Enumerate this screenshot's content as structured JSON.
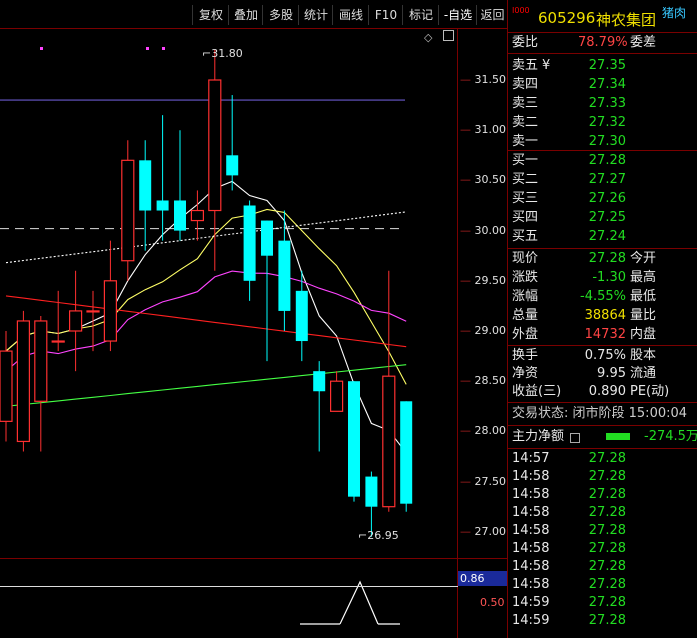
{
  "toolbar": {
    "buttons": [
      "复权",
      "叠加",
      "多股",
      "统计",
      "画线",
      "F10",
      "标记",
      "-自选",
      "返回"
    ]
  },
  "chart": {
    "price_ticks": [
      "31.50",
      "31.00",
      "30.50",
      "30.00",
      "29.50",
      "29.00",
      "28.50",
      "28.00",
      "27.50",
      "27.00"
    ],
    "high_label": "31.80",
    "low_label": "26.95",
    "sub_ticks": [
      "0.86",
      "0.50"
    ],
    "colors": {
      "up": "#ff3030",
      "down": "#00ffff",
      "ma5": "#ffffff",
      "ma10": "#ffff66",
      "ma20": "#ff44ff",
      "ma60": "#44ff44",
      "ma120": "#ff2020",
      "ref_white": "#ffffff",
      "ref_blue": "#6a5acd"
    }
  },
  "chart_data": {
    "type": "candlestick",
    "candles": [
      {
        "o": 28.1,
        "c": 28.8,
        "h": 29.0,
        "l": 27.9
      },
      {
        "o": 27.9,
        "c": 29.1,
        "h": 29.2,
        "l": 27.8
      },
      {
        "o": 28.3,
        "c": 29.1,
        "h": 29.15,
        "l": 27.8
      },
      {
        "o": 28.9,
        "c": 28.9,
        "h": 29.4,
        "l": 28.8
      },
      {
        "o": 29.0,
        "c": 29.2,
        "h": 29.6,
        "l": 28.6
      },
      {
        "o": 29.2,
        "c": 29.2,
        "h": 29.4,
        "l": 28.8
      },
      {
        "o": 28.9,
        "c": 29.5,
        "h": 29.9,
        "l": 28.8
      },
      {
        "o": 29.7,
        "c": 30.7,
        "h": 30.9,
        "l": 29.5
      },
      {
        "o": 30.7,
        "c": 30.2,
        "h": 30.9,
        "l": 29.8
      },
      {
        "o": 30.3,
        "c": 30.2,
        "h": 31.15,
        "l": 29.9
      },
      {
        "o": 30.3,
        "c": 30.0,
        "h": 31.0,
        "l": 29.9
      },
      {
        "o": 30.1,
        "c": 30.2,
        "h": 30.4,
        "l": 29.9
      },
      {
        "o": 30.2,
        "c": 31.5,
        "h": 31.8,
        "l": 29.6
      },
      {
        "o": 30.75,
        "c": 30.55,
        "h": 31.35,
        "l": 30.4
      },
      {
        "o": 30.25,
        "c": 29.5,
        "h": 30.3,
        "l": 29.3
      },
      {
        "o": 30.1,
        "c": 29.75,
        "h": 30.1,
        "l": 28.7
      },
      {
        "o": 29.9,
        "c": 29.2,
        "h": 30.2,
        "l": 29.0
      },
      {
        "o": 29.4,
        "c": 28.9,
        "h": 29.6,
        "l": 28.7
      },
      {
        "o": 28.6,
        "c": 28.4,
        "h": 28.7,
        "l": 27.8
      },
      {
        "o": 28.2,
        "c": 28.5,
        "h": 28.6,
        "l": 28.2
      },
      {
        "o": 28.5,
        "c": 27.35,
        "h": 28.5,
        "l": 27.3
      },
      {
        "o": 27.55,
        "c": 27.25,
        "h": 27.6,
        "l": 26.95
      },
      {
        "o": 27.25,
        "c": 28.55,
        "h": 29.6,
        "l": 27.2
      },
      {
        "o": 28.3,
        "c": 27.28,
        "h": 28.3,
        "l": 27.2
      }
    ]
  },
  "panel": {
    "code": "605296",
    "name": "神农集团",
    "tag": "猪肉",
    "weibi_label": "委比",
    "weibi_value": "78.79%",
    "weicha_label": "委差",
    "asks": [
      {
        "label": "卖五",
        "mark": "¥",
        "price": "27.35"
      },
      {
        "label": "卖四",
        "mark": "",
        "price": "27.34"
      },
      {
        "label": "卖三",
        "mark": "",
        "price": "27.33"
      },
      {
        "label": "卖二",
        "mark": "",
        "price": "27.32"
      },
      {
        "label": "卖一",
        "mark": "",
        "price": "27.30"
      }
    ],
    "bids": [
      {
        "label": "买一",
        "price": "27.28"
      },
      {
        "label": "买二",
        "price": "27.27"
      },
      {
        "label": "买三",
        "price": "27.26"
      },
      {
        "label": "买四",
        "price": "27.25"
      },
      {
        "label": "买五",
        "price": "27.24"
      }
    ],
    "stats": [
      {
        "l1": "现价",
        "v": "27.28",
        "vc": "green",
        "l2": "今开"
      },
      {
        "l1": "涨跌",
        "v": "-1.30",
        "vc": "green",
        "l2": "最高"
      },
      {
        "l1": "涨幅",
        "v": "-4.55%",
        "vc": "green",
        "l2": "最低"
      },
      {
        "l1": "总量",
        "v": "38864",
        "vc": "yellow",
        "l2": "量比"
      },
      {
        "l1": "外盘",
        "v": "14732",
        "vc": "red",
        "l2": "内盘"
      }
    ],
    "stats2": [
      {
        "l1": "换手",
        "v": "0.75%",
        "l2": "股本"
      },
      {
        "l1": "净资",
        "v": "9.95",
        "l2": "流通"
      },
      {
        "l1": "收益(三)",
        "v": "0.890",
        "l2": "PE(动)"
      }
    ],
    "trade_status": "交易状态: 闭市阶段 15:00:04",
    "main_flow_label": "主力净额",
    "main_flow_value": "-274.5万",
    "ticks": [
      {
        "t": "14:57",
        "p": "27.28"
      },
      {
        "t": "14:58",
        "p": "27.28"
      },
      {
        "t": "14:58",
        "p": "27.28"
      },
      {
        "t": "14:58",
        "p": "27.28"
      },
      {
        "t": "14:58",
        "p": "27.28"
      },
      {
        "t": "14:58",
        "p": "27.28"
      },
      {
        "t": "14:58",
        "p": "27.28"
      },
      {
        "t": "14:58",
        "p": "27.28"
      },
      {
        "t": "14:59",
        "p": "27.28"
      },
      {
        "t": "14:59",
        "p": "27.28"
      }
    ]
  }
}
